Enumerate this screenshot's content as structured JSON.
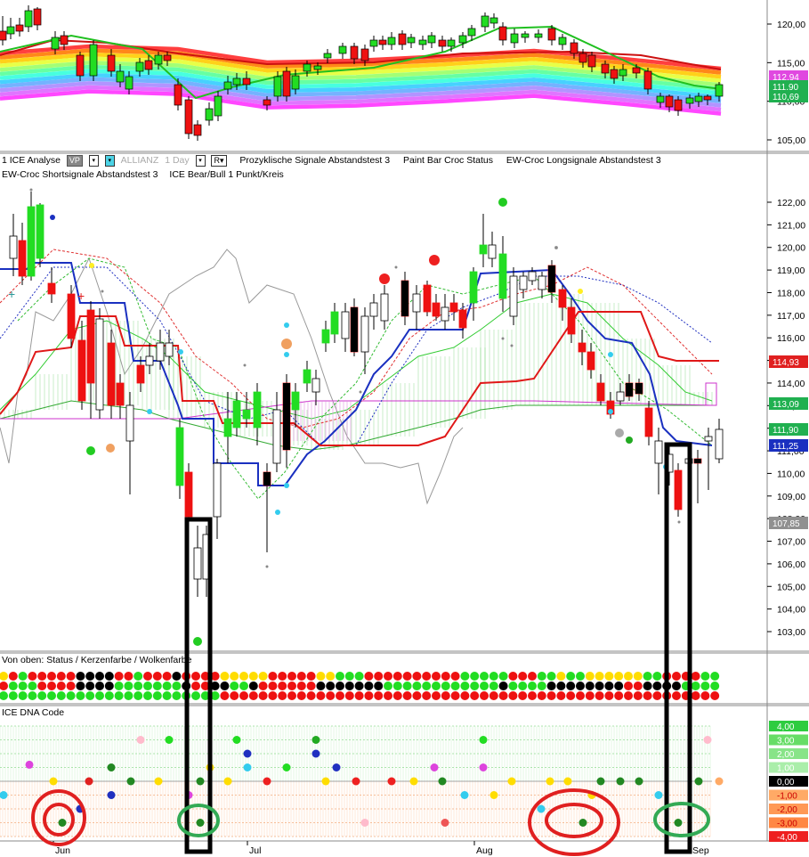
{
  "panel1": {
    "price_ticks": [
      "120,00",
      "115,00",
      "110,00",
      "105,00"
    ],
    "price_tags": [
      {
        "text": "112,94",
        "color": "#e048e0"
      },
      {
        "text": "111,90",
        "color": "#20b050"
      },
      {
        "text": "110,69",
        "color": "#20b050"
      }
    ]
  },
  "toolbar": {
    "item1": "1 ICE Analyse",
    "vp": "VP",
    "symbol": "ALLIANZ",
    "interval": "1 Day",
    "r_btn": "R▾",
    "item_cyc": "Prozyklische Signale Abstandstest 3",
    "item_paint": "Paint Bar Croc Status",
    "item_long": "EW-Croc Longsignale Abstandstest 3",
    "item_short": "EW-Croc Shortsignale Abstandstest 3",
    "item_bear": "ICE Bear/Bull 1 Punkt/Kreis"
  },
  "panel2": {
    "price_ticks": [
      "122,00",
      "121,00",
      "120,00",
      "119,00",
      "118,00",
      "117,00",
      "116,00",
      "115,00",
      "114,00",
      "113,00",
      "112,00",
      "111,00",
      "110,00",
      "109,00",
      "108,00",
      "107,00",
      "106,00",
      "105,00",
      "104,00",
      "103,00"
    ],
    "price_tags": [
      {
        "text": "114,93",
        "color": "#e02020"
      },
      {
        "text": "113,09",
        "color": "#20b050"
      },
      {
        "text": "111,90",
        "color": "#20b050"
      },
      {
        "text": "111,25",
        "color": "#1a30c0"
      },
      {
        "text": "107,85",
        "color": "#909090"
      }
    ]
  },
  "panel3": {
    "title": "Von oben: Status / Kerzenfarbe / Wolkenfarbe"
  },
  "panel4": {
    "title": "ICE DNA Code",
    "ticks": [
      {
        "text": "4,00",
        "bg": "#2ecc40",
        "fg": "#fff"
      },
      {
        "text": "3,00",
        "bg": "#66dd66",
        "fg": "#fff"
      },
      {
        "text": "2,00",
        "bg": "#88e488",
        "fg": "#fff"
      },
      {
        "text": "1,00",
        "bg": "#aaeeaa",
        "fg": "#fff"
      },
      {
        "text": "0,00",
        "bg": "#000",
        "fg": "#fff"
      },
      {
        "text": "-1,00",
        "bg": "#ffaa66",
        "fg": "#c00"
      },
      {
        "text": "-2,00",
        "bg": "#ff9955",
        "fg": "#c00"
      },
      {
        "text": "-3,00",
        "bg": "#ff8844",
        "fg": "#c00"
      },
      {
        "text": "-4,00",
        "bg": "#ee2020",
        "fg": "#fff"
      }
    ]
  },
  "time_axis": [
    "Jun",
    "Jul",
    "Aug",
    "Sep"
  ],
  "colors": {
    "bull": "#22dd22",
    "bear": "#ee1111",
    "kijun": "#1a30c0",
    "tenkan": "#e02020",
    "cloud": "#22bb22"
  }
}
